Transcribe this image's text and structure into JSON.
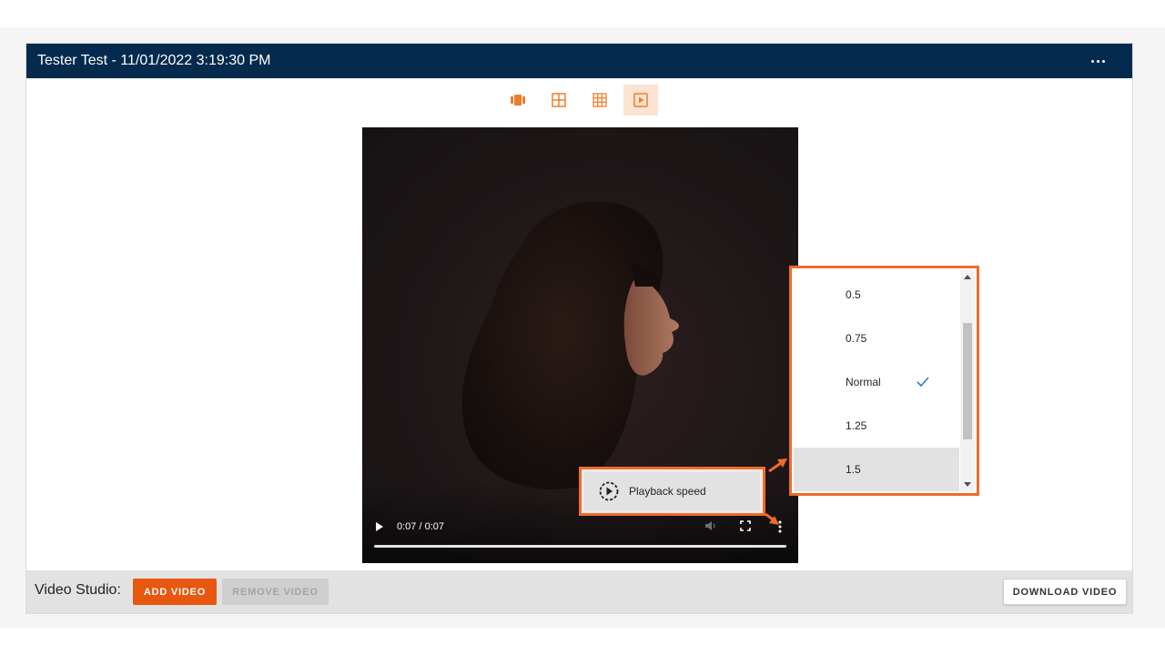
{
  "panel": {
    "title": "Tester Test - 11/01/2022 3:19:30 PM",
    "more_icon": "more-horizontal-icon"
  },
  "view_toolbar": {
    "buttons": [
      {
        "icon": "carousel-icon",
        "active": false
      },
      {
        "icon": "grid-2x2-icon",
        "active": false
      },
      {
        "icon": "grid-3x3-icon",
        "active": false
      },
      {
        "icon": "play-square-icon",
        "active": true
      }
    ],
    "accent_color": "#ef7d2c"
  },
  "video_player": {
    "time": "0:07 / 0:07",
    "progress": 1.0,
    "controls": [
      "play-icon",
      "volume-icon",
      "fullscreen-icon",
      "more-vertical-icon"
    ]
  },
  "playback_menu": {
    "item_label": "Playback speed",
    "icon": "playback-speed-icon"
  },
  "speed_menu": {
    "options": [
      "0.5",
      "0.75",
      "Normal",
      "1.25",
      "1.5"
    ],
    "selected": "Normal",
    "highlighted": "1.5"
  },
  "footer": {
    "label": "Video Studio:",
    "add_video": "ADD VIDEO",
    "remove_video": "REMOVE VIDEO",
    "download_video": "DOWNLOAD VIDEO"
  },
  "colors": {
    "header_bg": "#042a4d",
    "primary_button": "#e8570f",
    "callout_border": "#ef6c2a",
    "check": "#3b78d8"
  }
}
